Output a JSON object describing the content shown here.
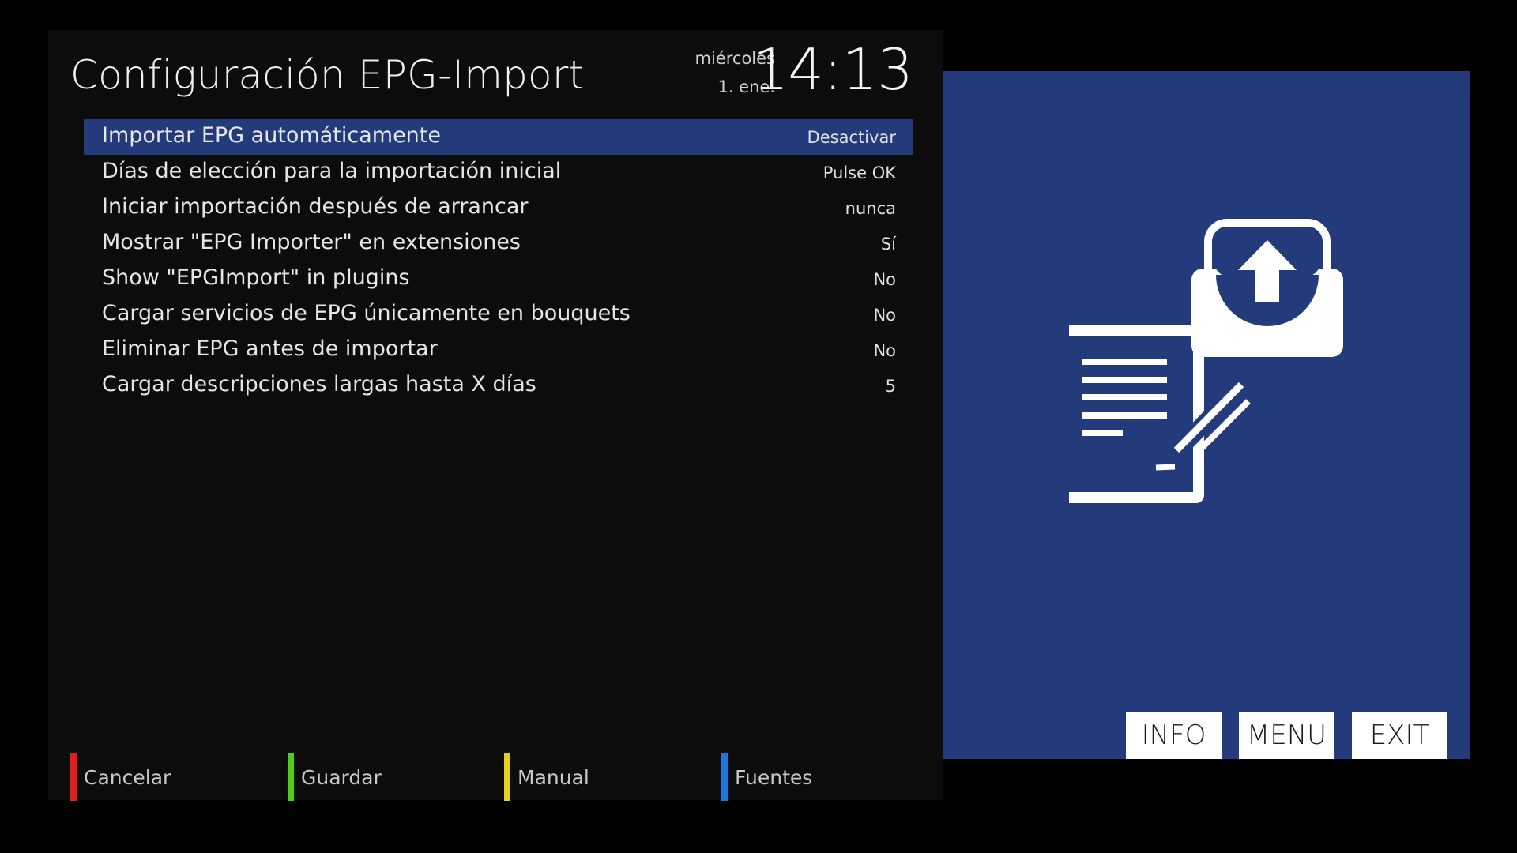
{
  "header": {
    "title": "Configuración EPG-Import",
    "weekday": "miércoles",
    "date": "1. ene.",
    "time": "14:13"
  },
  "settings": [
    {
      "label": "Importar EPG automáticamente",
      "value": "Desactivar",
      "selected": true
    },
    {
      "label": "Días de elección para la importación inicial",
      "value": "Pulse OK"
    },
    {
      "label": "Iniciar importación después de arrancar",
      "value": "nunca"
    },
    {
      "label": "Mostrar \"EPG Importer\" en extensiones",
      "value": "Sí"
    },
    {
      "label": "Show \"EPGImport\" in plugins",
      "value": "No"
    },
    {
      "label": "Cargar servicios de EPG únicamente en bouquets",
      "value": "No"
    },
    {
      "label": "Eliminar EPG antes de importar",
      "value": "No"
    },
    {
      "label": "Cargar descripciones largas hasta X días",
      "value": "5"
    }
  ],
  "color_keys": [
    {
      "label": "Cancelar",
      "color": "#e0211b"
    },
    {
      "label": "Guardar",
      "color": "#4fcf1a"
    },
    {
      "label": "Manual",
      "color": "#e6d21a"
    },
    {
      "label": "Fuentes",
      "color": "#1a78e0"
    }
  ],
  "hardware_buttons": {
    "info": "INFO",
    "menu": "MENU",
    "exit": "EXIT"
  },
  "icon": "epg-import-plugin-icon",
  "colors": {
    "panel_blue": "#233a7b",
    "selection_blue": "#233a7b",
    "panel_bg": "#0c0c0c"
  }
}
